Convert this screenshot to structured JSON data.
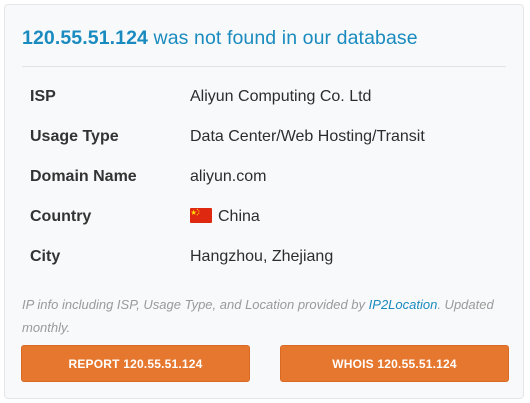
{
  "header": {
    "ip": "120.55.51.124",
    "message": " was not found in our database"
  },
  "details": [
    {
      "label": "ISP",
      "value": "Aliyun Computing Co. Ltd"
    },
    {
      "label": "Usage Type",
      "value": "Data Center/Web Hosting/Transit"
    },
    {
      "label": "Domain Name",
      "value": "aliyun.com"
    },
    {
      "label": "Country",
      "value": "China",
      "flag_icon": "china-flag-icon"
    },
    {
      "label": "City",
      "value": "Hangzhou, Zhejiang"
    }
  ],
  "note": {
    "prefix": "IP info including ISP, Usage Type, and Location provided by ",
    "link_text": "IP2Location",
    "suffix": ". Updated monthly."
  },
  "buttons": {
    "report_label": "REPORT 120.55.51.124",
    "whois_label": "WHOIS 120.55.51.124"
  },
  "colors": {
    "accent_blue": "#1a8bbf",
    "button_orange": "#e6772e",
    "card_background": "#f8f9fa"
  }
}
